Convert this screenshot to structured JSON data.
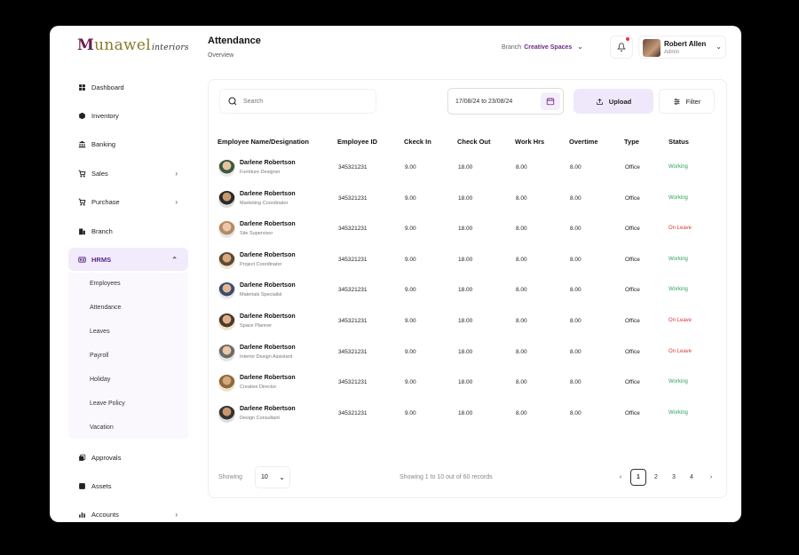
{
  "brand": {
    "m": "M",
    "rest": "unawel",
    "script": "interiors"
  },
  "sidebar": {
    "items": [
      {
        "label": "Dashboard",
        "icon": "grid-icon"
      },
      {
        "label": "Inventory",
        "icon": "box-icon"
      },
      {
        "label": "Banking",
        "icon": "bank-icon"
      },
      {
        "label": "Sales",
        "icon": "cart-icon",
        "chevron": "›"
      },
      {
        "label": "Purchase",
        "icon": "cart-icon",
        "chevron": "›"
      },
      {
        "label": "Branch",
        "icon": "building-icon"
      },
      {
        "label": "HRMS",
        "icon": "id-card-icon",
        "chevron": "⌃"
      },
      {
        "label": "Approvals",
        "icon": "approval-icon"
      },
      {
        "label": "Assets",
        "icon": "assets-icon"
      },
      {
        "label": "Accounts",
        "icon": "chart-icon",
        "chevron": "›"
      }
    ],
    "hrms_submenu": [
      "Employees",
      "Attendance",
      "Leaves",
      "Payroll",
      "Holiday",
      "Leave Policy",
      "Vacation"
    ]
  },
  "header": {
    "title": "Attendance",
    "subtitle": "Overview",
    "branch_label": "Branch",
    "branch_value": "Creative Spaces",
    "user_name": "Robert Allen",
    "user_role": "Admin"
  },
  "toolbar": {
    "search_placeholder": "Search",
    "date_range": "17/08/24 to 23/08/24",
    "upload_label": "Upload",
    "filter_label": "Filter"
  },
  "table": {
    "columns": [
      "Employee Name/Designation",
      "Employee ID",
      "Ckeck In",
      "Check Out",
      "Work Hrs",
      "Overtime",
      "Type",
      "Status"
    ],
    "rows": [
      {
        "name": "Darlene Robertson",
        "designation": "Furniture Designer",
        "id": "345321231",
        "check_in": "9.00",
        "check_out": "18.00",
        "work_hrs": "8.00",
        "overtime": "8.00",
        "type": "Office",
        "status": "Working"
      },
      {
        "name": "Darlene Robertson",
        "designation": "Marketing Coordinator",
        "id": "345321231",
        "check_in": "9.00",
        "check_out": "18.00",
        "work_hrs": "8.00",
        "overtime": "8.00",
        "type": "Office",
        "status": "Working"
      },
      {
        "name": "Darlene Robertson",
        "designation": "Site Supervisor",
        "id": "345321231",
        "check_in": "9.00",
        "check_out": "18.00",
        "work_hrs": "8.00",
        "overtime": "8.00",
        "type": "Office",
        "status": "On Leave"
      },
      {
        "name": "Darlene Robertson",
        "designation": "Project Coordinator",
        "id": "345321231",
        "check_in": "9.00",
        "check_out": "18.00",
        "work_hrs": "8.00",
        "overtime": "8.00",
        "type": "Office",
        "status": "Working"
      },
      {
        "name": "Darlene Robertson",
        "designation": "Materials Specialist",
        "id": "345321231",
        "check_in": "9.00",
        "check_out": "18.00",
        "work_hrs": "8.00",
        "overtime": "8.00",
        "type": "Office",
        "status": "Working"
      },
      {
        "name": "Darlene Robertson",
        "designation": "Space Planner",
        "id": "345321231",
        "check_in": "9.00",
        "check_out": "18.00",
        "work_hrs": "8.00",
        "overtime": "8.00",
        "type": "Office",
        "status": "On Leave"
      },
      {
        "name": "Darlene Robertson",
        "designation": "Interior Design Assistant",
        "id": "345321231",
        "check_in": "9.00",
        "check_out": "18.00",
        "work_hrs": "8.00",
        "overtime": "8.00",
        "type": "Office",
        "status": "On Leave"
      },
      {
        "name": "Darlene Robertson",
        "designation": "Creative Director",
        "id": "345321231",
        "check_in": "9.00",
        "check_out": "18.00",
        "work_hrs": "8.00",
        "overtime": "8.00",
        "type": "Office",
        "status": "Working"
      },
      {
        "name": "Darlene Robertson",
        "designation": "Design Consultant",
        "id": "345321231",
        "check_in": "9.00",
        "check_out": "18.00",
        "work_hrs": "8.00",
        "overtime": "8.00",
        "type": "Office",
        "status": "Working"
      }
    ]
  },
  "pagination": {
    "showing_label": "Showing",
    "page_size": "10",
    "records_text": "Showing 1 to 10 out of 60 records",
    "prev": "‹",
    "next": "›",
    "pages": [
      "1",
      "2",
      "3",
      "4"
    ],
    "current": "1"
  },
  "colors": {
    "accent": "#5b2a86",
    "active_bg": "#f1ebfb",
    "working": "#2fa45a",
    "on_leave": "#d63a2f"
  }
}
